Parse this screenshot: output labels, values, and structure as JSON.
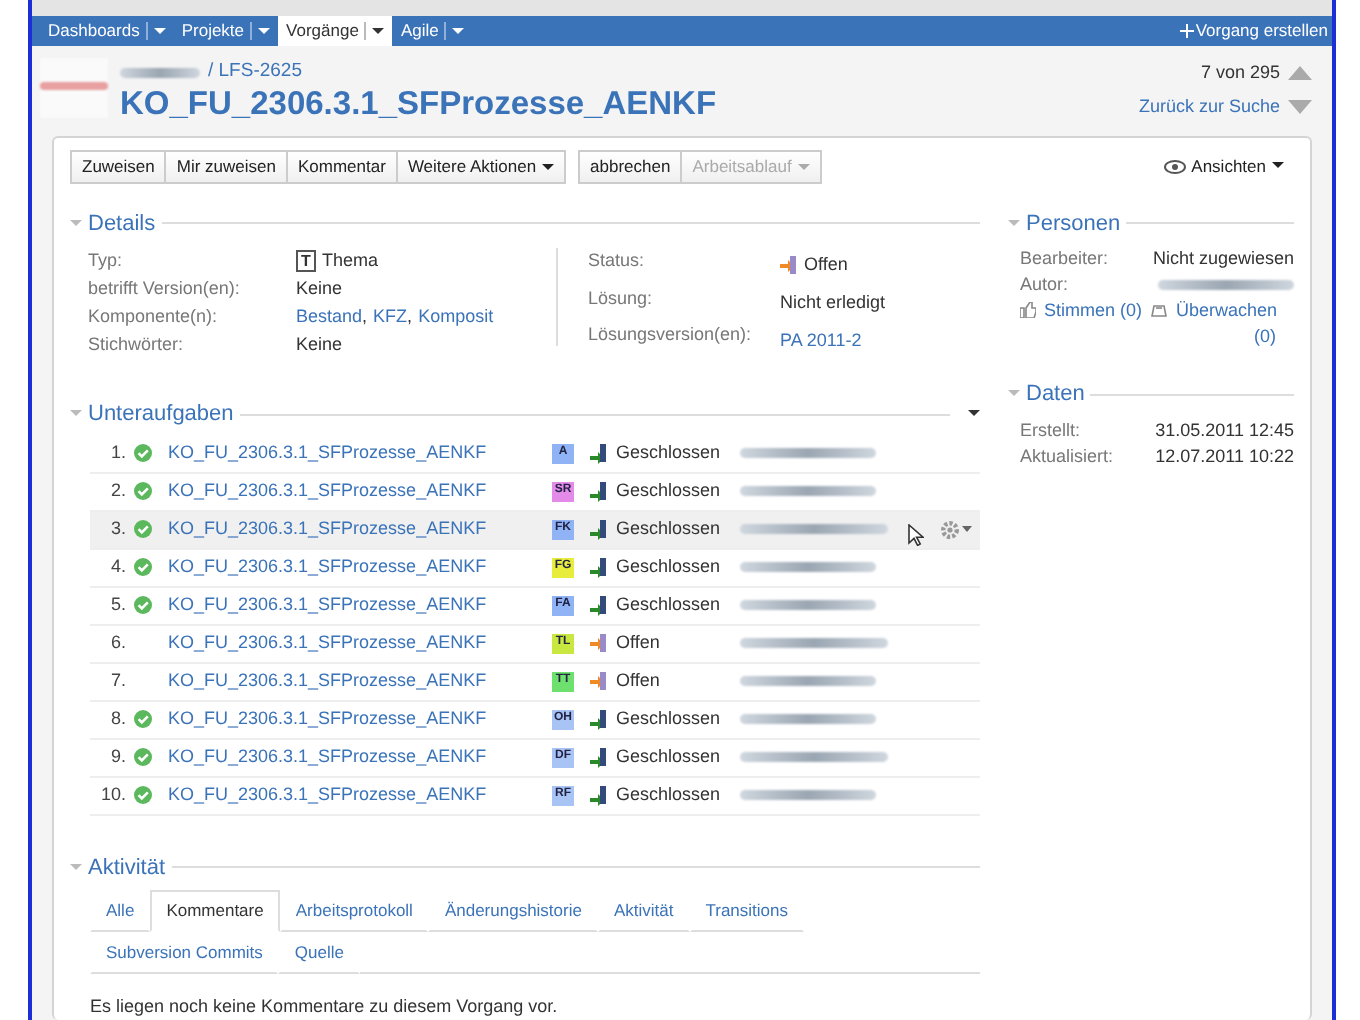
{
  "nav": {
    "items": [
      {
        "label": "Dashboards",
        "selected": false
      },
      {
        "label": "Projekte",
        "selected": false
      },
      {
        "label": "Vorgänge",
        "selected": true
      },
      {
        "label": "Agile",
        "selected": false
      }
    ],
    "create": "Vorgang erstellen"
  },
  "issue": {
    "breadcrumb": "/ LFS-2625",
    "title": "KO_FU_2306.3.1_SFProzesse_AENKF",
    "position": "7 von 295",
    "back_link": "Zurück zur Suche"
  },
  "toolbar": {
    "groups": [
      [
        {
          "label": "Zuweisen",
          "dropdown": false,
          "disabled": false
        },
        {
          "label": "Mir zuweisen",
          "dropdown": false,
          "disabled": false
        },
        {
          "label": "Kommentar",
          "dropdown": false,
          "disabled": false
        },
        {
          "label": "Weitere Aktionen",
          "dropdown": true,
          "disabled": false
        }
      ],
      [
        {
          "label": "abbrechen",
          "dropdown": false,
          "disabled": false
        },
        {
          "label": "Arbeitsablauf",
          "dropdown": true,
          "disabled": true
        }
      ]
    ],
    "views": "Ansichten"
  },
  "details": {
    "heading": "Details",
    "left": [
      {
        "label": "Typ:",
        "kind": "type",
        "icon": "T",
        "value": "Thema"
      },
      {
        "label": "betrifft Version(en):",
        "kind": "text",
        "value": "Keine"
      },
      {
        "label": "Komponente(n):",
        "kind": "links",
        "links": [
          "Bestand",
          "KFZ",
          "Komposit"
        ],
        "separator": ","
      },
      {
        "label": "Stichwörter:",
        "kind": "text",
        "value": "Keine"
      }
    ],
    "right": [
      {
        "label": "Status:",
        "kind": "status",
        "value": "Offen"
      },
      {
        "label": "Lösung:",
        "kind": "text",
        "value": "Nicht erledigt"
      },
      {
        "label": "Lösungsversion(en):",
        "kind": "links",
        "links": [
          "PA 2011-2"
        ]
      }
    ]
  },
  "people": {
    "heading": "Personen",
    "assignee_label": "Bearbeiter:",
    "assignee": "Nicht zugewiesen",
    "author_label": "Autor:",
    "votes": "Stimmen (0)",
    "watch": "Überwachen (0)"
  },
  "dates": {
    "heading": "Daten",
    "rows": [
      {
        "label": "Erstellt:",
        "value": "31.05.2011 12:45"
      },
      {
        "label": "Aktualisiert:",
        "value": "12.07.2011 10:22"
      }
    ]
  },
  "subtasks": {
    "heading": "Unteraufgaben",
    "rows": [
      {
        "num": "1.",
        "done": true,
        "title": "KO_FU_2306.3.1_SFProzesse_AENKF",
        "type": "A",
        "color": "#8fb3f5",
        "status": "Geschlossen",
        "closed": true,
        "highlighted": false
      },
      {
        "num": "2.",
        "done": true,
        "title": "KO_FU_2306.3.1_SFProzesse_AENKF",
        "type": "SR",
        "color": "#e48ae8",
        "status": "Geschlossen",
        "closed": true,
        "highlighted": false
      },
      {
        "num": "3.",
        "done": true,
        "title": "KO_FU_2306.3.1_SFProzesse_AENKF",
        "type": "FK",
        "color": "#8fb3f5",
        "status": "Geschlossen",
        "closed": true,
        "highlighted": true
      },
      {
        "num": "4.",
        "done": true,
        "title": "KO_FU_2306.3.1_SFProzesse_AENKF",
        "type": "FG",
        "color": "#e8ec3a",
        "status": "Geschlossen",
        "closed": true,
        "highlighted": false
      },
      {
        "num": "5.",
        "done": true,
        "title": "KO_FU_2306.3.1_SFProzesse_AENKF",
        "type": "FA",
        "color": "#8fb3f5",
        "status": "Geschlossen",
        "closed": true,
        "highlighted": false
      },
      {
        "num": "6.",
        "done": false,
        "title": "KO_FU_2306.3.1_SFProzesse_AENKF",
        "type": "TL",
        "color": "#c8e840",
        "status": "Offen",
        "closed": false,
        "highlighted": false
      },
      {
        "num": "7.",
        "done": false,
        "title": "KO_FU_2306.3.1_SFProzesse_AENKF",
        "type": "TT",
        "color": "#6ee06e",
        "status": "Offen",
        "closed": false,
        "highlighted": false
      },
      {
        "num": "8.",
        "done": true,
        "title": "KO_FU_2306.3.1_SFProzesse_AENKF",
        "type": "OH",
        "color": "#a8c4f5",
        "status": "Geschlossen",
        "closed": true,
        "highlighted": false
      },
      {
        "num": "9.",
        "done": true,
        "title": "KO_FU_2306.3.1_SFProzesse_AENKF",
        "type": "DF",
        "color": "#a8c4f5",
        "status": "Geschlossen",
        "closed": true,
        "highlighted": false
      },
      {
        "num": "10.",
        "done": true,
        "title": "KO_FU_2306.3.1_SFProzesse_AENKF",
        "type": "RF",
        "color": "#a8c4f5",
        "status": "Geschlossen",
        "closed": true,
        "highlighted": false
      }
    ]
  },
  "activity": {
    "heading": "Aktivität",
    "tabs": [
      [
        {
          "label": "Alle",
          "selected": false
        },
        {
          "label": "Kommentare",
          "selected": true
        },
        {
          "label": "Arbeitsprotokoll",
          "selected": false
        },
        {
          "label": "Änderungshistorie",
          "selected": false
        },
        {
          "label": "Aktivität",
          "selected": false
        },
        {
          "label": "Transitions",
          "selected": false
        }
      ],
      [
        {
          "label": "Subversion Commits",
          "selected": false
        },
        {
          "label": "Quelle",
          "selected": false
        }
      ]
    ],
    "message": "Es liegen noch keine Kommentare zu diesem Vorgang vor."
  }
}
